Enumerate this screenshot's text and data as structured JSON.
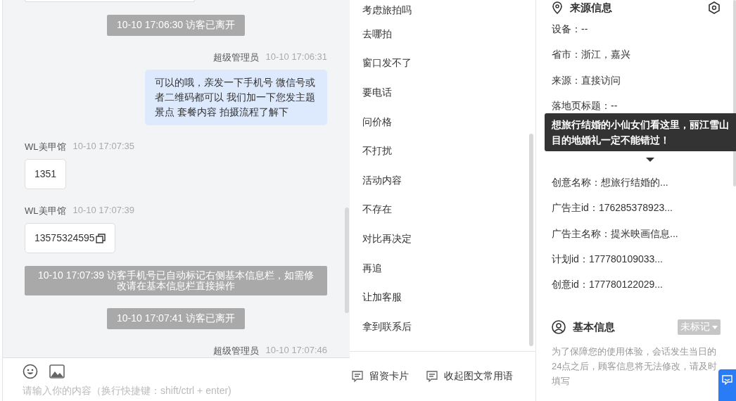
{
  "chat": {
    "messages": [
      {
        "kind": "system",
        "text": "10-10 17:06:30 访客已离开"
      },
      {
        "kind": "agent",
        "sender": "超级管理员",
        "time": "10-10 17:06:31",
        "text": "可以的哦，亲发一下手机号 微信号或者二维码都可以 我们加一下您发主题景点 套餐内容 拍摄流程了解下"
      },
      {
        "kind": "visitor",
        "sender": "WL美甲馆",
        "time": "10-10 17:07:35",
        "text": "1351",
        "copyable": false
      },
      {
        "kind": "visitor",
        "sender": "WL美甲馆",
        "time": "10-10 17:07:39",
        "text": "13575324595",
        "copyable": true
      },
      {
        "kind": "notice",
        "text": "10-10 17:07:39 访客手机号已自动标记右侧基本信息栏，如需修改请在基本信息栏直接操作"
      },
      {
        "kind": "system",
        "text": "10-10 17:07:41 访客已离开"
      },
      {
        "kind": "agent",
        "sender": "超级管理员",
        "time": "10-10 17:07:46"
      }
    ],
    "composer": {
      "placeholder": "请输入你的内容（换行快捷键：shift/ctrl + enter)"
    }
  },
  "phrases": {
    "items": [
      "考虑旅拍吗",
      "去哪拍",
      "窗口发不了",
      "要电话",
      "问价格",
      "不打扰",
      "活动内容",
      "不存在",
      "对比再决定",
      "再追",
      "让加客服",
      "拿到联系后"
    ],
    "actions": [
      "留资卡片",
      "收起图文常用语"
    ]
  },
  "source_info": {
    "title": "来源信息",
    "fields": [
      "设备：--",
      "省市：浙江，嘉兴",
      "来源：直接访问",
      "落地页标题：--",
      "创意名称：想旅行结婚的...",
      "广告主id：176285378923...",
      "广告主名称：提米映画信息...",
      "计划id：177780109033...",
      "创意id：177780122029..."
    ],
    "tooltip": "想旅行结婚的小仙女们看这里，丽江雪山目的地婚礼一定不能错过！"
  },
  "basic_info": {
    "title": "基本信息",
    "tag": "未标记",
    "note": "为了保障您的使用体验，会话发生当日的24点之后，顾客信息将无法修改，请及时填写"
  }
}
